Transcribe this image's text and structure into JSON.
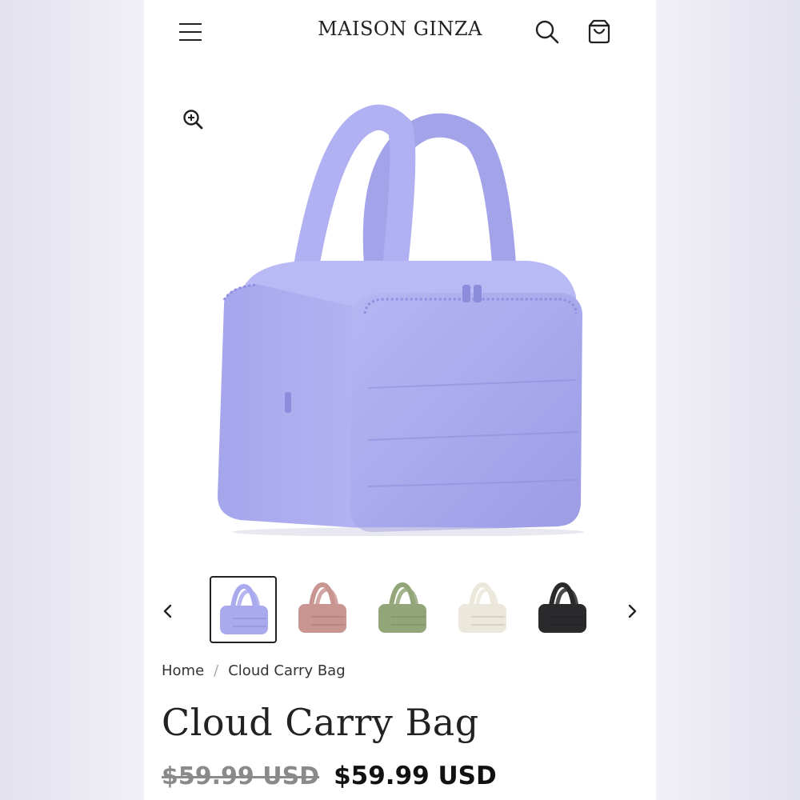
{
  "header": {
    "brand": "MAISON GINZA",
    "icons": [
      "menu-icon",
      "search-icon",
      "cart-icon"
    ]
  },
  "gallery": {
    "zoom_icon": "zoom-in-icon",
    "main_color": "#a8a8ee",
    "thumbnails": [
      {
        "name": "lavender",
        "color": "#a9a9ee",
        "active": true
      },
      {
        "name": "pink",
        "color": "#c99590",
        "active": false
      },
      {
        "name": "green",
        "color": "#93a679",
        "active": false
      },
      {
        "name": "cream",
        "color": "#ece7db",
        "active": false
      },
      {
        "name": "black",
        "color": "#2a2a2c",
        "active": false
      }
    ]
  },
  "breadcrumb": {
    "home": "Home",
    "separator": "/",
    "current": "Cloud Carry Bag"
  },
  "product": {
    "title": "Cloud Carry Bag",
    "compare_price": "$59.99 USD",
    "price": "$59.99 USD"
  }
}
